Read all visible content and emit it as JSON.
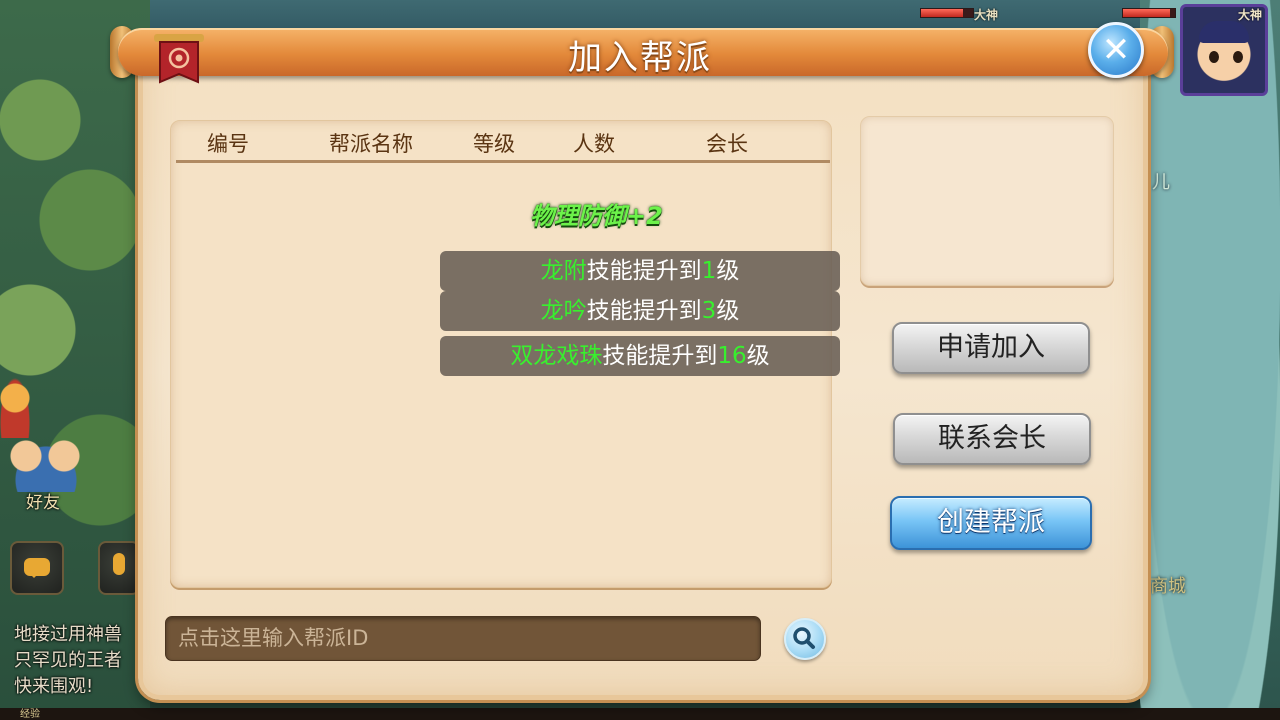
{
  "dialog": {
    "title": "加入帮派",
    "close_icon": "close-icon"
  },
  "list": {
    "columns": [
      "编号",
      "帮派名称",
      "等级",
      "人数",
      "会长"
    ],
    "rows": []
  },
  "buff": {
    "title": "物理防御+2",
    "skills": [
      {
        "name": "龙附",
        "text": "技能提升到",
        "level": "1",
        "suffix": "级"
      },
      {
        "name": "龙吟",
        "text": "技能提升到",
        "level": "3",
        "suffix": "级"
      },
      {
        "name": "双龙戏珠",
        "text": "技能提升到",
        "level": "16",
        "suffix": "级"
      }
    ]
  },
  "actions": {
    "apply": "申请加入",
    "contact": "联系会长",
    "create": "创建帮派"
  },
  "search": {
    "placeholder": "点击这里输入帮派ID",
    "icon": "magnifier-icon"
  },
  "hud": {
    "player_tag_1": "大神",
    "player_tag_2": "大神",
    "avatar_label": "大神",
    "friends_label": "好友",
    "shop_label": "商城",
    "right_text": "儿",
    "chat_lines": [
      "地接过用神兽",
      "只罕见的王者",
      "快来围观!"
    ],
    "exp_label": "经验"
  },
  "colors": {
    "title_bar": "#e3893a",
    "highlight_green": "#38f02e",
    "buff_green": "#6cf24a",
    "create_button": "#79c5f6"
  }
}
